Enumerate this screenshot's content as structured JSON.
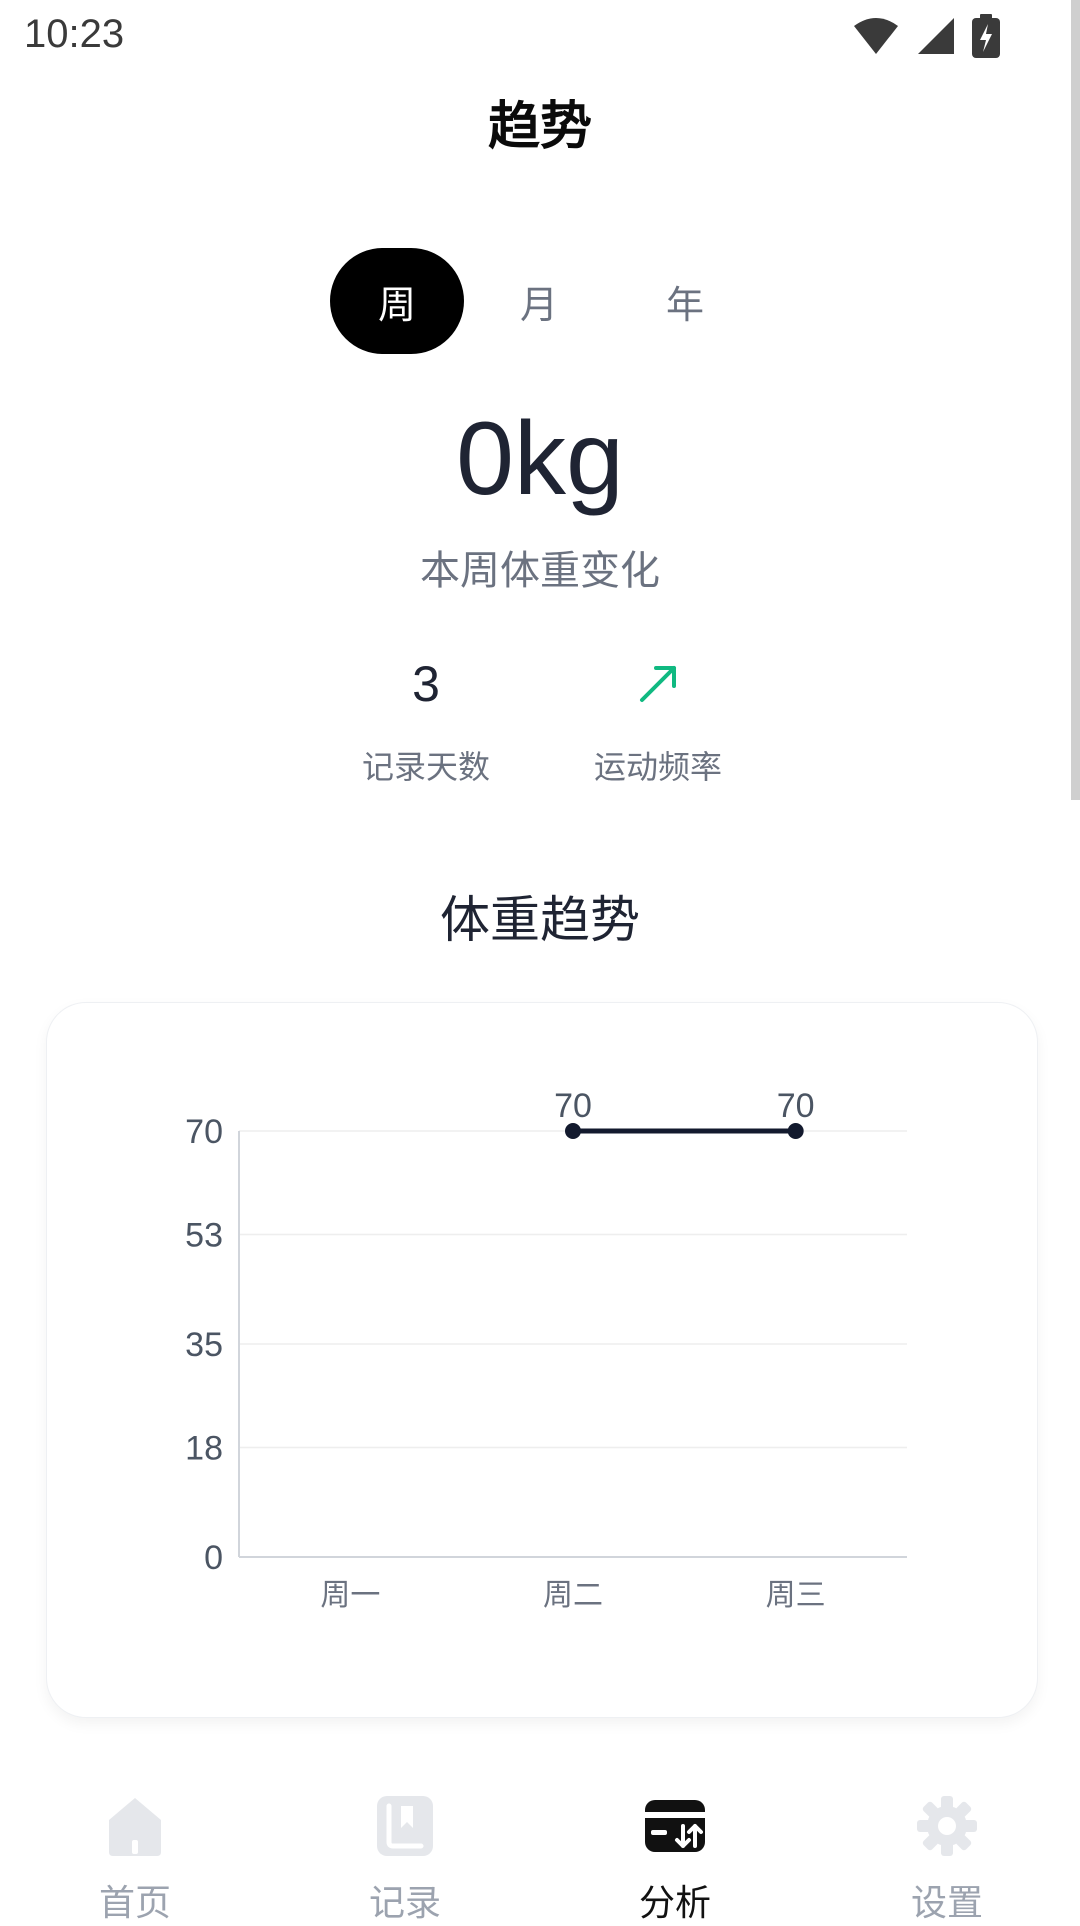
{
  "status_bar": {
    "time": "10:23",
    "icons": [
      "wifi-icon",
      "signal-icon",
      "battery-charging-icon"
    ]
  },
  "header": {
    "title": "趋势"
  },
  "period_tabs": {
    "items": [
      "周",
      "月",
      "年"
    ],
    "selected": "周"
  },
  "summary": {
    "weight_change": "0kg",
    "weight_change_label": "本周体重变化"
  },
  "stats": {
    "record_days_value": "3",
    "record_days_label": "记录天数",
    "exercise_freq_icon": "trend-up-arrow-icon",
    "exercise_freq_label": "运动频率"
  },
  "section": {
    "title": "体重趋势"
  },
  "chart_data": {
    "type": "line",
    "categories": [
      "周一",
      "周二",
      "周三"
    ],
    "yticks": [
      0,
      18,
      35,
      53,
      70
    ],
    "ylim": [
      0,
      70
    ],
    "series": [
      {
        "values": [
          null,
          70,
          70
        ],
        "labels": [
          "",
          "70",
          "70"
        ]
      }
    ],
    "grid": true,
    "colors": {
      "line": "#131a2e",
      "grid": "#eeeeee",
      "axis": "#d1d5db",
      "tick": "#4b5563"
    }
  },
  "tabbar": {
    "items": [
      {
        "label": "首页",
        "icon": "home-icon"
      },
      {
        "label": "记录",
        "icon": "book-icon"
      },
      {
        "label": "分析",
        "icon": "analytics-card-icon"
      },
      {
        "label": "设置",
        "icon": "gear-icon"
      }
    ],
    "active_index": 2
  },
  "colors": {
    "accent_green": "#10b981",
    "active": "#000000",
    "inactive": "#9ca3af"
  }
}
